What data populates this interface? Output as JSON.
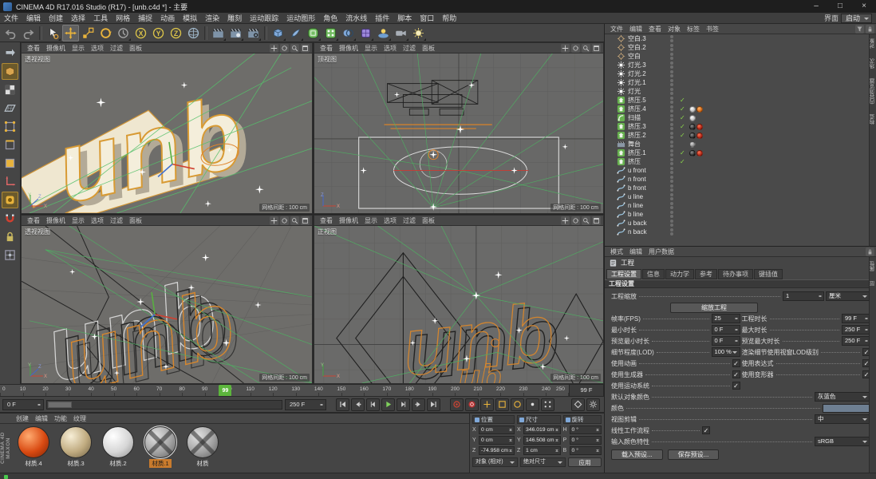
{
  "colors": {
    "accent_orange": "#e8a33c",
    "playhead_green": "#5cb53c",
    "viewport_bg": "#6b6b6b",
    "panel_bg": "#454545",
    "object_swatch": "#6e7f92"
  },
  "titlebar": {
    "title": "CINEMA 4D R17.016 Studio (R17) - [unb.c4d *] - 主要",
    "minimize": "–",
    "maximize": "□",
    "close": "×"
  },
  "menubar": {
    "items": [
      "文件",
      "编辑",
      "创建",
      "选择",
      "工具",
      "网格",
      "捕捉",
      "动画",
      "模拟",
      "渲染",
      "雕刻",
      "运动跟踪",
      "运动图形",
      "角色",
      "流水线",
      "插件",
      "脚本",
      "窗口",
      "帮助"
    ],
    "interface_label": "界面",
    "interface_value": "启动"
  },
  "toolbar": {
    "items": [
      {
        "icon": "undo",
        "name": "undo"
      },
      {
        "icon": "redo",
        "name": "redo"
      },
      {
        "icon": "sep"
      },
      {
        "icon": "live-selection",
        "name": "live-selection-tool",
        "corner": true
      },
      {
        "icon": "move",
        "name": "move-tool",
        "active": true
      },
      {
        "icon": "scale",
        "name": "scale-tool"
      },
      {
        "icon": "rotate",
        "name": "rotate-tool"
      },
      {
        "icon": "recent",
        "name": "last-used-tool",
        "corner": true
      },
      {
        "icon": "axis-x",
        "name": "lock-x-axis"
      },
      {
        "icon": "axis-y",
        "name": "lock-y-axis"
      },
      {
        "icon": "axis-z",
        "name": "lock-z-axis"
      },
      {
        "icon": "coords",
        "name": "coordinate-system"
      },
      {
        "icon": "sep"
      },
      {
        "icon": "render-view",
        "name": "render-view",
        "corner": true
      },
      {
        "icon": "render-pv",
        "name": "render-to-picture-viewer",
        "corner": true
      },
      {
        "icon": "render-settings",
        "name": "render-settings",
        "corner": true
      },
      {
        "icon": "sep"
      },
      {
        "icon": "cube",
        "name": "add-primitive",
        "corner": true
      },
      {
        "icon": "pen",
        "name": "add-spline",
        "corner": true
      },
      {
        "icon": "subdiv",
        "name": "add-subdivision-surface",
        "corner": true
      },
      {
        "icon": "array",
        "name": "add-generator",
        "corner": true
      },
      {
        "icon": "boole",
        "name": "add-modeling-object",
        "corner": true
      },
      {
        "icon": "deformer",
        "name": "add-deformer",
        "corner": true
      },
      {
        "icon": "environment",
        "name": "add-environment",
        "corner": true
      },
      {
        "icon": "camera",
        "name": "add-camera",
        "corner": true
      },
      {
        "icon": "light",
        "name": "add-light",
        "corner": true
      }
    ]
  },
  "palette": {
    "items": [
      {
        "icon": "convert",
        "name": "make-editable"
      },
      {
        "icon": "model",
        "name": "model-mode",
        "active": true
      },
      {
        "icon": "texture",
        "name": "texture-mode"
      },
      {
        "icon": "workplane",
        "name": "workplane-mode"
      },
      {
        "icon": "points",
        "name": "points-mode"
      },
      {
        "icon": "edges",
        "name": "edges-mode"
      },
      {
        "icon": "polygons",
        "name": "polygons-mode"
      },
      {
        "icon": "axis",
        "name": "enable-axis-modification"
      },
      {
        "icon": "paint",
        "name": "viewport-solo",
        "active": true
      },
      {
        "icon": "snap",
        "name": "enable-snap"
      },
      {
        "icon": "lock",
        "name": "lock-workplane"
      },
      {
        "icon": "quantize",
        "name": "enable-quantizing"
      }
    ]
  },
  "viewports": {
    "menu": [
      "查看",
      "摄像机",
      "显示",
      "选项",
      "过滤",
      "面板"
    ],
    "corner_icons": [
      "pan",
      "orbit",
      "zoom",
      "maximize"
    ],
    "grid_label": "网格间距 : 100 cm",
    "logo_text": "unb",
    "logo_text_small": "ub",
    "panels": [
      {
        "label": "透视视图"
      },
      {
        "label": "顶视图"
      },
      {
        "label": "透视视图"
      },
      {
        "label": "正视图"
      }
    ]
  },
  "object_manager": {
    "menu": [
      "文件",
      "编辑",
      "查看",
      "对象",
      "标签",
      "书签"
    ],
    "side_tabs": [
      "对象",
      "场次",
      "内容浏览器",
      "构造"
    ],
    "items": [
      {
        "label": "空白.3",
        "icon": "null-obj"
      },
      {
        "label": "空白.2",
        "icon": "null-obj"
      },
      {
        "label": "空白",
        "icon": "null-obj"
      },
      {
        "label": "灯光.3",
        "icon": "lightobj"
      },
      {
        "label": "灯光.2",
        "icon": "lightobj"
      },
      {
        "label": "灯光.1",
        "icon": "lightobj"
      },
      {
        "label": "灯光",
        "icon": "lightobj"
      },
      {
        "label": "挤压.5",
        "icon": "extrude",
        "check": true
      },
      {
        "label": "挤压.4",
        "icon": "extrude",
        "check": true,
        "tags": [
          "mat-white",
          "mat-orange"
        ]
      },
      {
        "label": "扫描",
        "icon": "sweep",
        "check": true,
        "tags": [
          "mat-white"
        ]
      },
      {
        "label": "挤压.3",
        "icon": "extrude",
        "check": true,
        "tags": [
          "mat-dark",
          "mat-red"
        ]
      },
      {
        "label": "挤压.2",
        "icon": "extrude",
        "check": true,
        "tags": [
          "mat-dark",
          "mat-red"
        ]
      },
      {
        "label": "舞台",
        "icon": "stage",
        "tags": [
          "mat-gray"
        ]
      },
      {
        "label": "挤压.1",
        "icon": "extrude",
        "check": true,
        "tags": [
          "mat-dark",
          "mat-red"
        ]
      },
      {
        "label": "挤压",
        "icon": "extrude",
        "check": true
      },
      {
        "label": "u front",
        "icon": "spline"
      },
      {
        "label": "n front",
        "icon": "spline"
      },
      {
        "label": "b front",
        "icon": "spline"
      },
      {
        "label": "u line",
        "icon": "spline"
      },
      {
        "label": "n line",
        "icon": "spline"
      },
      {
        "label": "b line",
        "icon": "spline"
      },
      {
        "label": "u back",
        "icon": "spline"
      },
      {
        "label": "n back",
        "icon": "spline"
      }
    ]
  },
  "attributes": {
    "menu": [
      "模式",
      "编辑",
      "用户数据"
    ],
    "object_label": "工程",
    "tabs": [
      "工程设置",
      "信息",
      "动力学",
      "参考",
      "待办事项",
      "键插值"
    ],
    "active_tab": "工程设置",
    "section": "工程设置",
    "side_tabs": [
      "属性",
      "层"
    ],
    "rows": {
      "scale_label": "工程缩放",
      "scale_value": "1",
      "scale_unit": "厘米",
      "scale_button": "缩放工程",
      "fps_label": "帧率(FPS)",
      "fps": "25",
      "duration_label": "工程时长",
      "duration": "99 F",
      "min_label": "最小时长",
      "min": "0 F",
      "max_label": "最大时长",
      "max": "250 F",
      "pmin_label": "预览最小时长",
      "pmin": "0 F",
      "pmax_label": "预览最大时长",
      "pmax": "250 F",
      "lod_label": "细节程度(LOD)",
      "lod": "100 %",
      "lod_render_label": "渲染细节使用视窗LOD级别",
      "use_animation": "使用动画",
      "use_expressions": "使用表达式",
      "use_generators": "使用生成器",
      "use_deformers": "使用变形器",
      "use_motion": "使用运动系统",
      "default_color_label": "默认对象颜色",
      "default_color": "灰蓝色",
      "color_label": "颜色",
      "color_value": "#6e7f92",
      "view_clip_label": "视图剪辑",
      "view_clip": "中",
      "lwf_label": "线性工作流程",
      "input_profile_label": "输入颜色特性",
      "input_profile": "sRGB",
      "load_preset": "载入预设...",
      "save_preset": "保存预设..."
    }
  },
  "timeline": {
    "ticks": [
      "0",
      "10",
      "20",
      "30",
      "40",
      "50",
      "60",
      "70",
      "80",
      "90",
      "100",
      "110",
      "120",
      "130",
      "140",
      "150",
      "160",
      "170",
      "180",
      "190",
      "200",
      "210",
      "220",
      "230",
      "240",
      "250"
    ],
    "max_frame": 250,
    "playhead": "99",
    "current_field": "99 F",
    "range_start": "0 F",
    "range_end": "250 F"
  },
  "transport": {
    "buttons": [
      {
        "icon": "tostart",
        "name": "go-to-start"
      },
      {
        "icon": "prevkey",
        "name": "previous-key"
      },
      {
        "icon": "prevframe",
        "name": "previous-frame"
      },
      {
        "icon": "play",
        "name": "play-forward"
      },
      {
        "icon": "nextframe",
        "name": "next-frame"
      },
      {
        "icon": "nextkey",
        "name": "next-key"
      },
      {
        "icon": "toend",
        "name": "go-to-end"
      }
    ],
    "record_buttons": [
      {
        "icon": "reckey",
        "name": "record-active-objects"
      },
      {
        "icon": "autokey",
        "name": "autokeying"
      },
      {
        "icon": "recpos",
        "name": "record-position"
      },
      {
        "icon": "recscale",
        "name": "record-scale"
      },
      {
        "icon": "recrot",
        "name": "record-rotation"
      },
      {
        "icon": "recparam",
        "name": "record-parameter"
      },
      {
        "icon": "recpla",
        "name": "point-level-animation"
      }
    ],
    "extra_buttons": [
      {
        "icon": "keydiamond",
        "name": "keyframe-selection"
      },
      {
        "icon": "gearsm",
        "name": "playback-settings"
      }
    ]
  },
  "materials": {
    "menu": [
      "创建",
      "编辑",
      "功能",
      "纹理"
    ],
    "items": [
      {
        "name": "材质.4",
        "ball": "ball-red"
      },
      {
        "name": "材质.3",
        "ball": "ball-beige"
      },
      {
        "name": "材质.2",
        "ball": "ball-white"
      },
      {
        "name": "材质.1",
        "ball": "ball-grayx",
        "selected": true
      },
      {
        "name": "材质",
        "ball": "ball-grayx"
      }
    ]
  },
  "coordinates": {
    "groups": [
      {
        "title": "位置",
        "rows": [
          {
            "axis": "X",
            "value": "0 cm"
          },
          {
            "axis": "Y",
            "value": "0 cm"
          },
          {
            "axis": "Z",
            "value": "-74.958 cm"
          }
        ]
      },
      {
        "title": "尺寸",
        "rows": [
          {
            "axis": "X",
            "value": "346.019 cm"
          },
          {
            "axis": "Y",
            "value": "146.508 cm"
          },
          {
            "axis": "Z",
            "value": "1 cm"
          }
        ]
      },
      {
        "title": "旋转",
        "rows": [
          {
            "axis": "H",
            "value": "0 °"
          },
          {
            "axis": "P",
            "value": "0 °"
          },
          {
            "axis": "B",
            "value": "0 °"
          }
        ]
      }
    ],
    "mode_dropdown": "对象 (相对)",
    "size_dropdown": "绝对尺寸",
    "apply_button": "应用"
  },
  "brand": {
    "line1": "MAXON",
    "line2": "CINEMA 4D"
  }
}
